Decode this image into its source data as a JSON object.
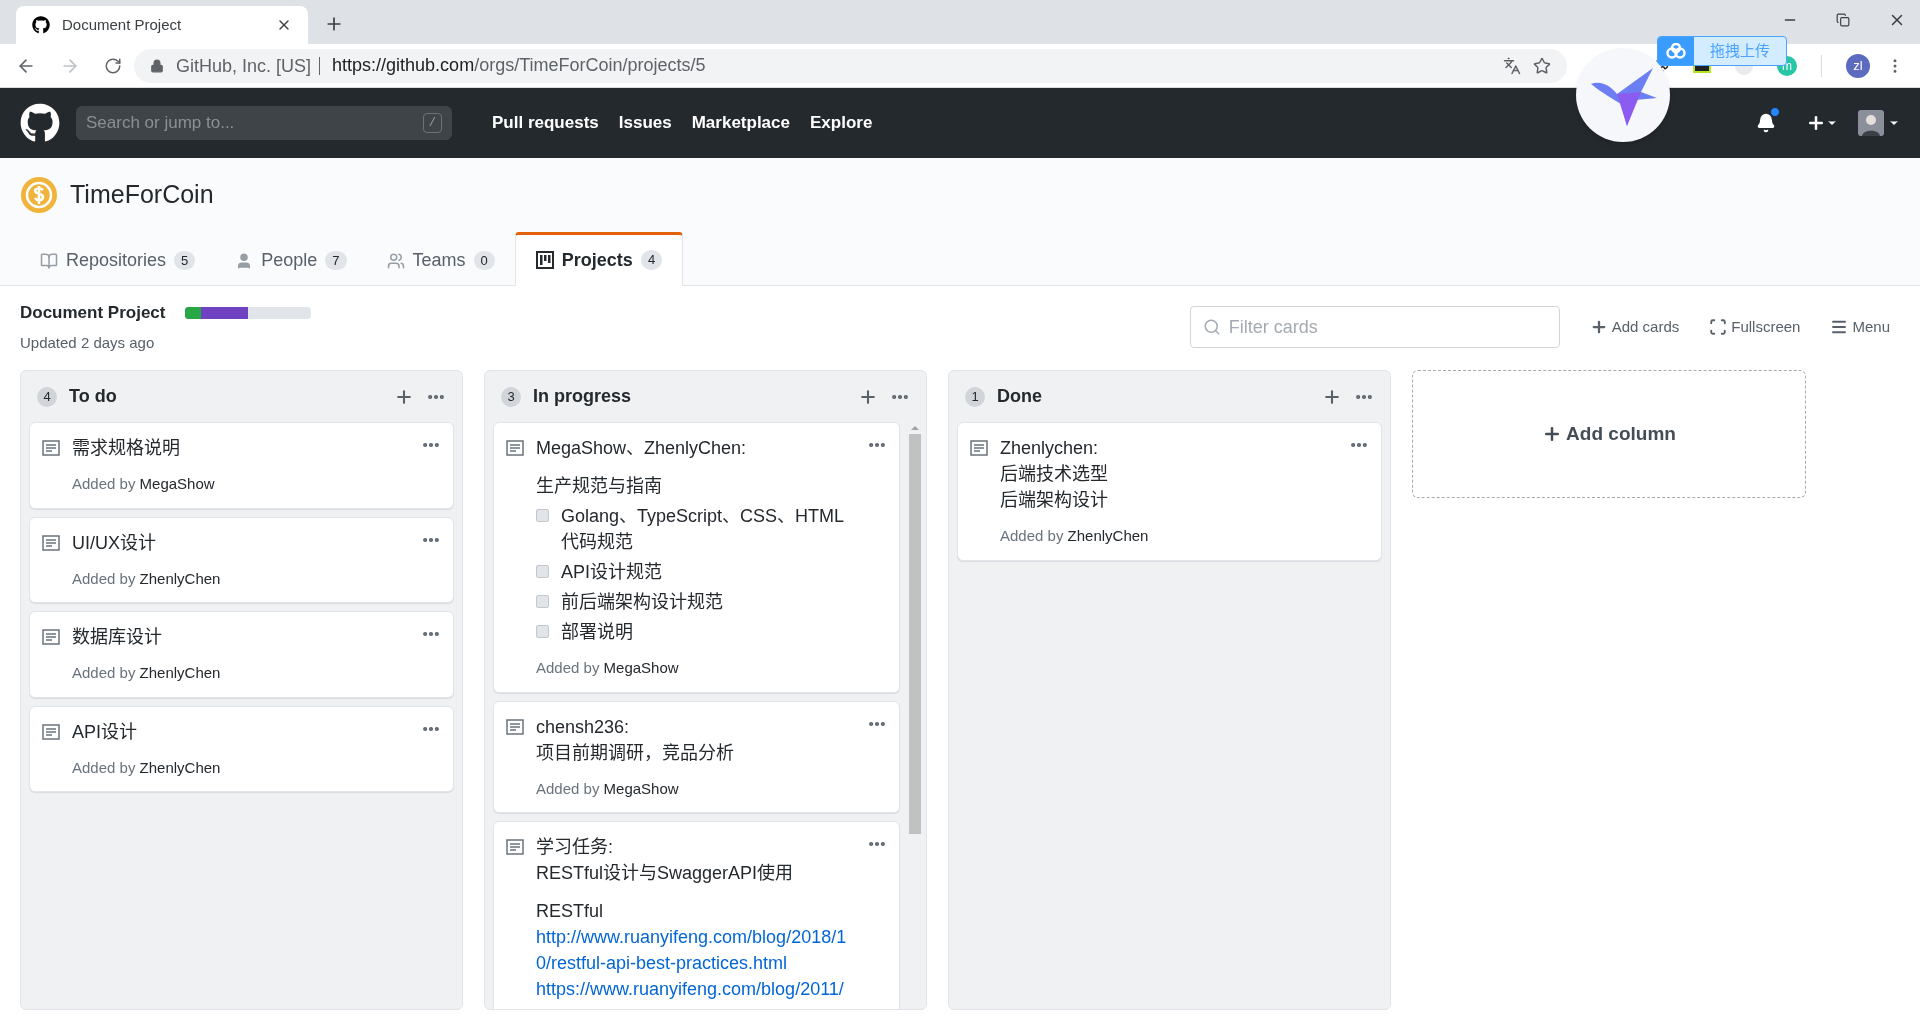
{
  "browser": {
    "tab_title": "Document Project",
    "site": "GitHub, Inc. [US]",
    "url_host": "https://github.com",
    "url_path": "/orgs/TimeForCoin/projects/5",
    "extension_letter": "m",
    "profile": "zl"
  },
  "upload_widget": {
    "label": "拖拽上传"
  },
  "header": {
    "search_placeholder": "Search or jump to...",
    "search_key": "/",
    "nav": [
      "Pull requests",
      "Issues",
      "Marketplace",
      "Explore"
    ],
    "notification": true
  },
  "org": {
    "name": "TimeForCoin",
    "tabs": [
      {
        "kind": "repo",
        "label": "Repositories",
        "count": "5",
        "selected": false
      },
      {
        "kind": "person",
        "label": "People",
        "count": "7",
        "selected": false
      },
      {
        "kind": "team",
        "label": "Teams",
        "count": "0",
        "selected": false
      },
      {
        "kind": "project",
        "label": "Projects",
        "count": "4",
        "selected": true
      }
    ]
  },
  "project": {
    "name": "Document Project",
    "updated": "Updated 2 days ago",
    "progress": [
      {
        "color": "#28a745",
        "level": 0.125
      },
      {
        "color": "#6f42c1",
        "level": 0.5
      }
    ],
    "filter_placeholder": "Filter cards",
    "actions": [
      {
        "kind": "add",
        "label": "Add cards"
      },
      {
        "kind": "fullscreen",
        "label": "Fullscreen"
      },
      {
        "kind": "menu",
        "label": "Menu"
      }
    ]
  },
  "columns": [
    {
      "count": "4",
      "name": "To do",
      "scrollable": false,
      "cards": [
        {
          "blocks": [
            {
              "kind": "text",
              "text": "需求规格说明"
            }
          ],
          "added_label": "Added by",
          "author": "MegaShow"
        },
        {
          "blocks": [
            {
              "kind": "text",
              "text": "UI/UX设计"
            }
          ],
          "added_label": "Added by",
          "author": "ZhenlyChen"
        },
        {
          "blocks": [
            {
              "kind": "text",
              "text": "数据库设计"
            }
          ],
          "added_label": "Added by",
          "author": "ZhenlyChen"
        },
        {
          "blocks": [
            {
              "kind": "text",
              "text": "API设计"
            }
          ],
          "added_label": "Added by",
          "author": "ZhenlyChen"
        }
      ]
    },
    {
      "count": "3",
      "name": "In progress",
      "scrollable": true,
      "cards": [
        {
          "blocks": [
            {
              "kind": "text",
              "text": "MegaShow、ZhenlyChen:"
            },
            {
              "kind": "heading",
              "text": "生产规范与指南"
            },
            {
              "kind": "task",
              "text": "Golang、TypeScript、CSS、HTML代码规范",
              "checked": false
            },
            {
              "kind": "task",
              "text": "API设计规范",
              "checked": false
            },
            {
              "kind": "task",
              "text": "前后端架构设计规范",
              "checked": false
            },
            {
              "kind": "task",
              "text": "部署说明",
              "checked": false
            }
          ],
          "added_label": "Added by",
          "author": "MegaShow"
        },
        {
          "blocks": [
            {
              "kind": "text",
              "text": "chensh236:"
            },
            {
              "kind": "text",
              "text": "项目前期调研，竞品分析"
            }
          ],
          "added_label": "Added by",
          "author": "MegaShow"
        },
        {
          "blocks": [
            {
              "kind": "text",
              "text": "学习任务:"
            },
            {
              "kind": "text",
              "text": "RESTful设计与SwaggerAPI使用"
            },
            {
              "kind": "heading",
              "text": "RESTful"
            },
            {
              "kind": "link",
              "text": "http://www.ruanyifeng.com/blog/2018/10/restful-api-best-practices.html"
            },
            {
              "kind": "link",
              "text": "https://www.ruanyifeng.com/blog/2011/"
            }
          ]
        }
      ]
    },
    {
      "count": "1",
      "name": "Done",
      "scrollable": false,
      "cards": [
        {
          "blocks": [
            {
              "kind": "text",
              "text": "Zhenlychen:"
            },
            {
              "kind": "text",
              "text": "后端技术选型"
            },
            {
              "kind": "text",
              "text": "后端架构设计"
            }
          ],
          "added_label": "Added by",
          "author": "ZhenlyChen"
        }
      ]
    }
  ],
  "add_column": "Add column"
}
